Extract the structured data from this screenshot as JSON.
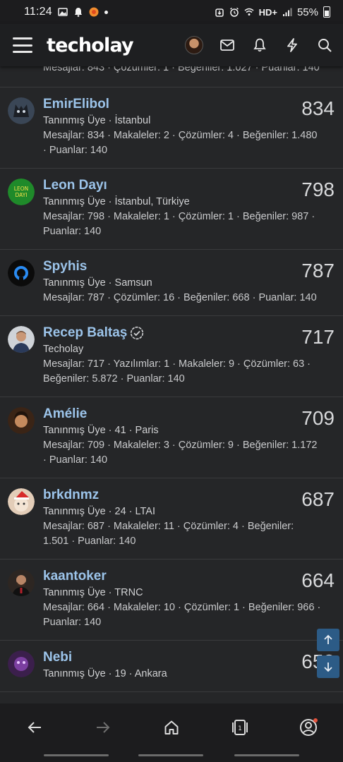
{
  "status": {
    "time": "11:24",
    "network": "HD+",
    "battery": "55%"
  },
  "header": {
    "logo": "techolay"
  },
  "partial_row": {
    "stats": "Mesajlar: 843 · Çözümler: 1 · Beğeniler: 1.027 · Puanlar: 140"
  },
  "members": [
    {
      "name": "EmirElibol",
      "score": "834",
      "meta": "Tanınmış Üye · İstanbul",
      "stats": "Mesajlar: 834 · Makaleler: 2 · Çözümler: 4 · Beğeniler: 1.480 · Puanlar: 140",
      "avatar_color": "#3a4656"
    },
    {
      "name": "Leon Dayı",
      "score": "798",
      "meta": "Tanınmış Üye · İstanbul, Türkiye",
      "stats": "Mesajlar: 798 · Makaleler: 1 · Çözümler: 1 · Beğeniler: 987 · Puanlar: 140",
      "avatar_color": "#1f8a2a",
      "avatar_text": "LEON DAYI"
    },
    {
      "name": "Spyhis",
      "score": "787",
      "meta": "Tanınmış Üye · Samsun",
      "stats": "Mesajlar: 787 · Çözümler: 16 · Beğeniler: 668 · Puanlar: 140",
      "avatar_color": "#0b0b0b"
    },
    {
      "name": "Recep Baltaş",
      "score": "717",
      "meta": "Techolay",
      "stats": "Mesajlar: 717 · Yazılımlar: 1 · Makaleler: 9 · Çözümler: 63 · Beğeniler: 5.872 · Puanlar: 140",
      "avatar_color": "#8a7766",
      "verified": true
    },
    {
      "name": "Amélie",
      "score": "709",
      "meta": "Tanınmış Üye · 41 · Paris",
      "stats": "Mesajlar: 709 · Makaleler: 3 · Çözümler: 9 · Beğeniler: 1.172 · Puanlar: 140",
      "avatar_color": "#5a3a22"
    },
    {
      "name": "brkdnmz",
      "score": "687",
      "meta": "Tanınmış Üye · 24 · LTAI",
      "stats": "Mesajlar: 687 · Makaleler: 11 · Çözümler: 4 · Beğeniler: 1.501 · Puanlar: 140",
      "avatar_color": "#d8b59a"
    },
    {
      "name": "kaantoker",
      "score": "664",
      "meta": "Tanınmış Üye · TRNC",
      "stats": "Mesajlar: 664 · Makaleler: 10 · Çözümler: 1 · Beğeniler: 966 · Puanlar: 140",
      "avatar_color": "#3b2a24"
    },
    {
      "name": "Nebi",
      "score": "653",
      "meta": "Tanınmış Üye · 19 · Ankara",
      "stats": "",
      "avatar_color": "#5a2f6e"
    }
  ],
  "colors": {
    "accent": "#9cc4ea",
    "fab": "#2c5b86",
    "background": "#252628"
  }
}
